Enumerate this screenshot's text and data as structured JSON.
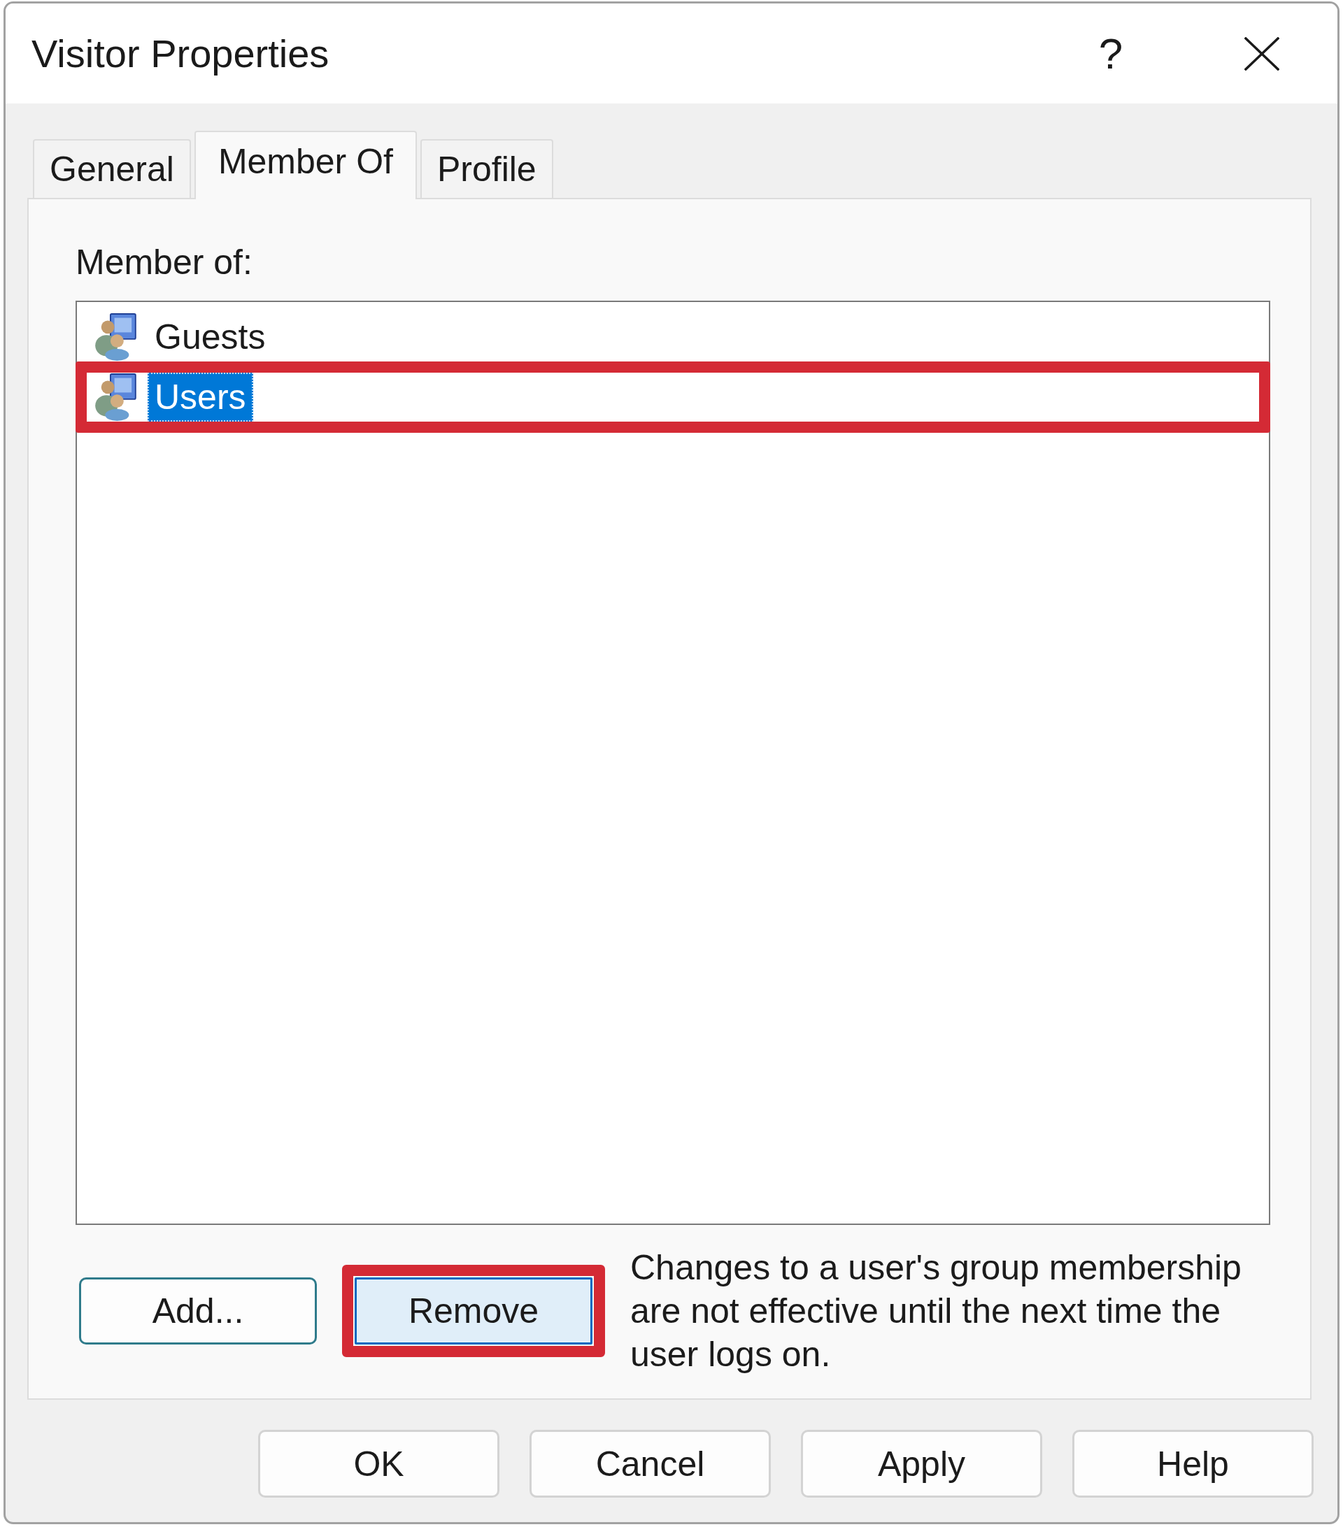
{
  "window": {
    "title": "Visitor Properties",
    "help_button": "?"
  },
  "tabs": [
    {
      "label": "General",
      "selected": false
    },
    {
      "label": "Member Of",
      "selected": true
    },
    {
      "label": "Profile",
      "selected": false
    }
  ],
  "member_of": {
    "label": "Member of:",
    "groups": [
      {
        "name": "Guests",
        "selected": false,
        "highlighted": false
      },
      {
        "name": "Users",
        "selected": true,
        "highlighted": true
      }
    ]
  },
  "actions": [
    {
      "label": "Add...",
      "focused": true,
      "hovered": false,
      "highlighted": false
    },
    {
      "label": "Remove",
      "focused": false,
      "hovered": true,
      "highlighted": true
    }
  ],
  "note": "Changes to a user's group membership are not effective until the next time the user logs on.",
  "buttons": [
    {
      "label": "OK"
    },
    {
      "label": "Cancel"
    },
    {
      "label": "Apply"
    },
    {
      "label": "Help"
    }
  ]
}
